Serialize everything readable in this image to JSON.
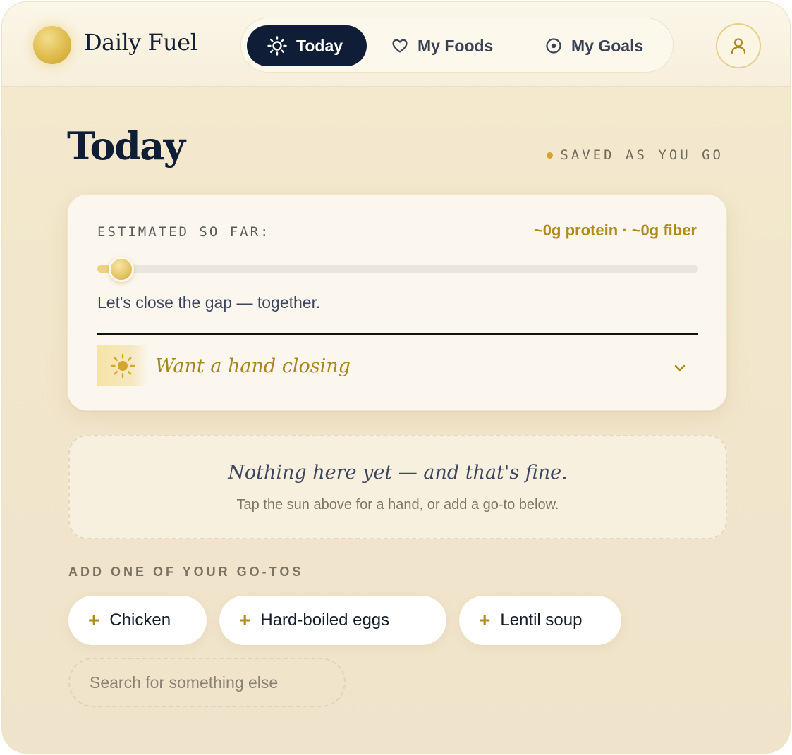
{
  "header": {
    "brand": "Daily Fuel",
    "tabs": [
      {
        "label": "Today",
        "icon": "sun-icon",
        "active": true
      },
      {
        "label": "My Foods",
        "icon": "heart-icon",
        "active": false
      },
      {
        "label": "My Goals",
        "icon": "target-icon",
        "active": false
      }
    ],
    "profile_icon": "user-icon"
  },
  "page": {
    "title": "Today",
    "saved_status": "SAVED AS YOU GO"
  },
  "summary": {
    "label": "ESTIMATED SO FAR:",
    "macros": "~0g protein · ~0g fiber",
    "progress_fraction": 0.04,
    "message": "Let's close the gap — together.",
    "hand_prompt": "Want a hand closing"
  },
  "empty_state": {
    "title": "Nothing here yet — and that's fine.",
    "subtitle": "Tap the sun above for a hand, or add a go-to below."
  },
  "gotos": {
    "label": "ADD ONE OF YOUR GO-TOS",
    "items": [
      {
        "label": "Chicken"
      },
      {
        "label": "Hard-boiled eggs"
      },
      {
        "label": "Lentil soup"
      }
    ],
    "search_placeholder": "Search for something else"
  },
  "colors": {
    "accent": "#b18a1c",
    "nav_active": "#0f1e36",
    "background": "#f4eacd"
  }
}
